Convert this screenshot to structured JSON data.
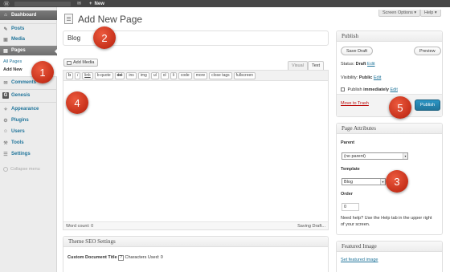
{
  "adminbar": {
    "wp_icon": "wordpress-logo-icon",
    "comments_icon": "comment-bubble-icon",
    "new_label": "New",
    "plus_glyph": "+"
  },
  "sidebar": {
    "items": [
      {
        "label": "Dashboard",
        "icon": "dashboard-icon",
        "glyph": "⌂"
      },
      {
        "label": "Posts",
        "icon": "pin-icon",
        "glyph": "✎"
      },
      {
        "label": "Media",
        "icon": "media-icon",
        "glyph": "▣"
      },
      {
        "label": "Pages",
        "icon": "pages-icon",
        "glyph": "▤"
      },
      {
        "label": "Comments",
        "icon": "comments-icon",
        "glyph": "✉"
      },
      {
        "label": "Genesis",
        "icon": "genesis-icon",
        "glyph": "G"
      },
      {
        "label": "Appearance",
        "icon": "appearance-icon",
        "glyph": "✧"
      },
      {
        "label": "Plugins",
        "icon": "plugin-icon",
        "glyph": "⚙"
      },
      {
        "label": "Users",
        "icon": "users-icon",
        "glyph": "☺"
      },
      {
        "label": "Tools",
        "icon": "tools-icon",
        "glyph": "⚒"
      },
      {
        "label": "Settings",
        "icon": "settings-icon",
        "glyph": "☰"
      }
    ],
    "submenu": [
      "All Pages",
      "Add New"
    ],
    "collapse_label": "Collapse menu"
  },
  "header": {
    "screen_options": "Screen Options ▾",
    "help": "Help ▾",
    "title": "Add New Page"
  },
  "editor": {
    "title_value": "Blog",
    "add_media": "Add Media",
    "tab_visual": "Visual",
    "tab_text": "Text",
    "quicktags": [
      "b",
      "i",
      "link",
      "b-quote",
      "del",
      "ins",
      "img",
      "ul",
      "ol",
      "li",
      "code",
      "more",
      "close tags",
      "fullscreen"
    ],
    "word_count": "Word count: 0",
    "saving": "Saving Draft..."
  },
  "publish": {
    "heading": "Publish",
    "save_draft": "Save Draft",
    "preview": "Preview",
    "status_label": "Status:",
    "status_value": "Draft",
    "edit": "Edit",
    "visibility_label": "Visibility:",
    "visibility_value": "Public",
    "publish_label": "Publish",
    "publish_value": "immediately",
    "trash": "Move to Trash",
    "publish_button": "Publish"
  },
  "attributes": {
    "heading": "Page Attributes",
    "parent_label": "Parent",
    "parent_value": "(no parent)",
    "template_label": "Template",
    "template_value": "Blog",
    "order_label": "Order",
    "order_value": "0",
    "help_line1": "Need help? Use the Help tab in the upper right",
    "help_line2": "of your screen."
  },
  "seo": {
    "heading": "Theme SEO Settings",
    "doc_title": "Custom Document Title",
    "q": "?",
    "chars": "Characters Used: 0"
  },
  "featured": {
    "heading": "Featured Image",
    "link": "Set featured image"
  },
  "callouts": [
    "1",
    "2",
    "3",
    "4",
    "5"
  ],
  "colors": {
    "accent": "#21759b",
    "callout": "#c6301a",
    "adminbar": "#464646",
    "trash": "#bc0b0b"
  }
}
